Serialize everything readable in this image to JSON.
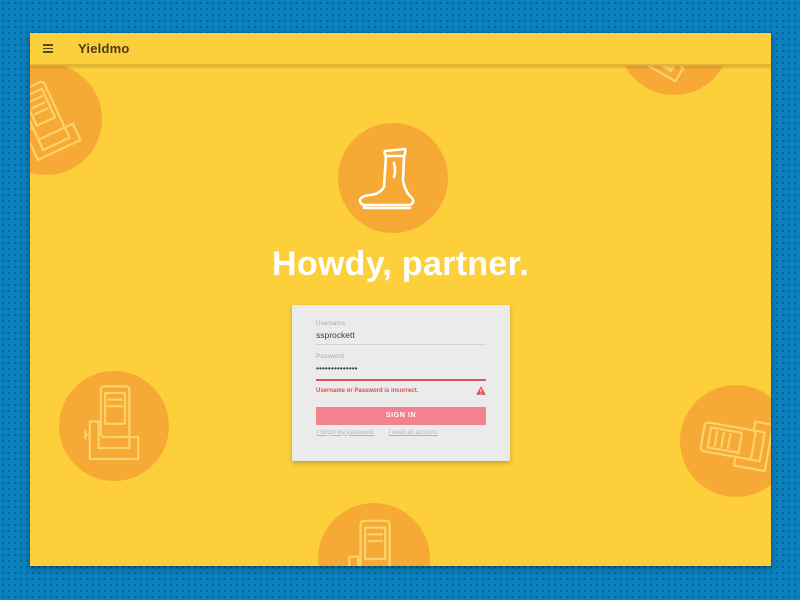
{
  "app": {
    "title": "Yieldmo"
  },
  "hero": {
    "icon": "cowboy-boot-icon",
    "headline": "Howdy, partner."
  },
  "login": {
    "username_label": "Username",
    "username_value": "ssprockett",
    "password_label": "Password",
    "password_value": "••••••••••••••",
    "error_text": "Username or Password is incorrect.",
    "signin_label": "SIGN IN",
    "forgot_link": "I forgot my password.",
    "need_account_link": "I need an account."
  },
  "decorations": {
    "icon": "phone-device-icon"
  },
  "colors": {
    "page_background": "#0a80bd",
    "app_background": "#fccf3b",
    "accent_circle": "#f6a935",
    "error": "#e0505b",
    "signin_button": "#f3818e",
    "card_background": "#ebebeb"
  }
}
